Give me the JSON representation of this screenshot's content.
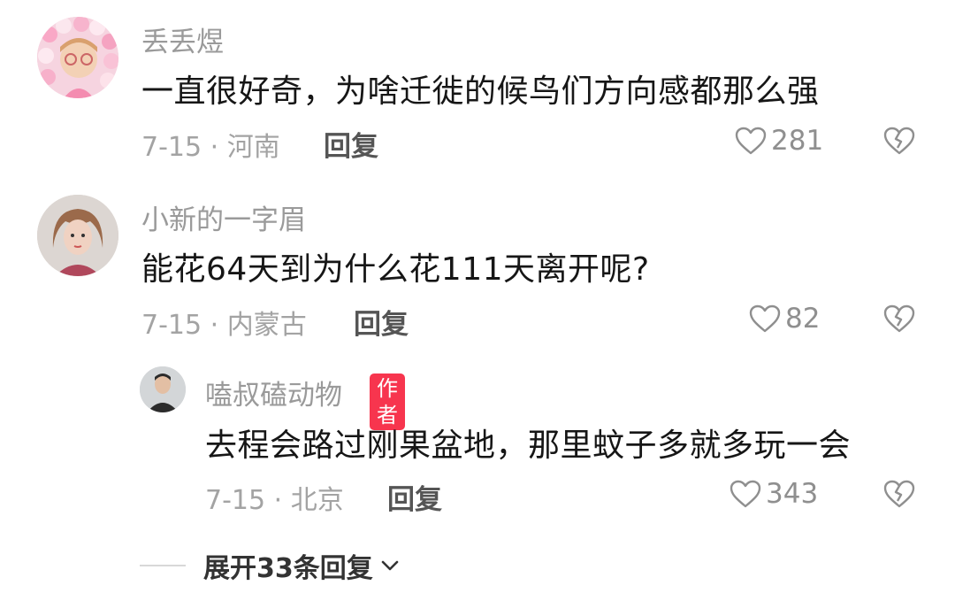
{
  "comments": [
    {
      "username": "丢丢煜",
      "text": "一直很好奇，为啥迁徙的候鸟们方向感都那么强",
      "date_location": "7-15 · 河南",
      "reply_label": "回复",
      "likes": "281"
    },
    {
      "username": "小新的一字眉",
      "text": "能花64天到为什么花111天离开呢?",
      "date_location": "7-15 · 内蒙古",
      "reply_label": "回复",
      "likes": "82"
    }
  ],
  "reply": {
    "username": "嗑叔磕动物",
    "badge": "作者",
    "text": "去程会路过刚果盆地，那里蚊子多就多玩一会",
    "date_location": "7-15 · 北京",
    "reply_label": "回复",
    "likes": "343"
  },
  "expand": {
    "label": "展开33条回复"
  },
  "colors": {
    "badge": "#f7354e",
    "username": "#9a9a9a",
    "text": "#161616",
    "meta": "#a3a3a3"
  },
  "icons": [
    "heart-icon",
    "broken-heart-icon",
    "chevron-down-icon"
  ]
}
